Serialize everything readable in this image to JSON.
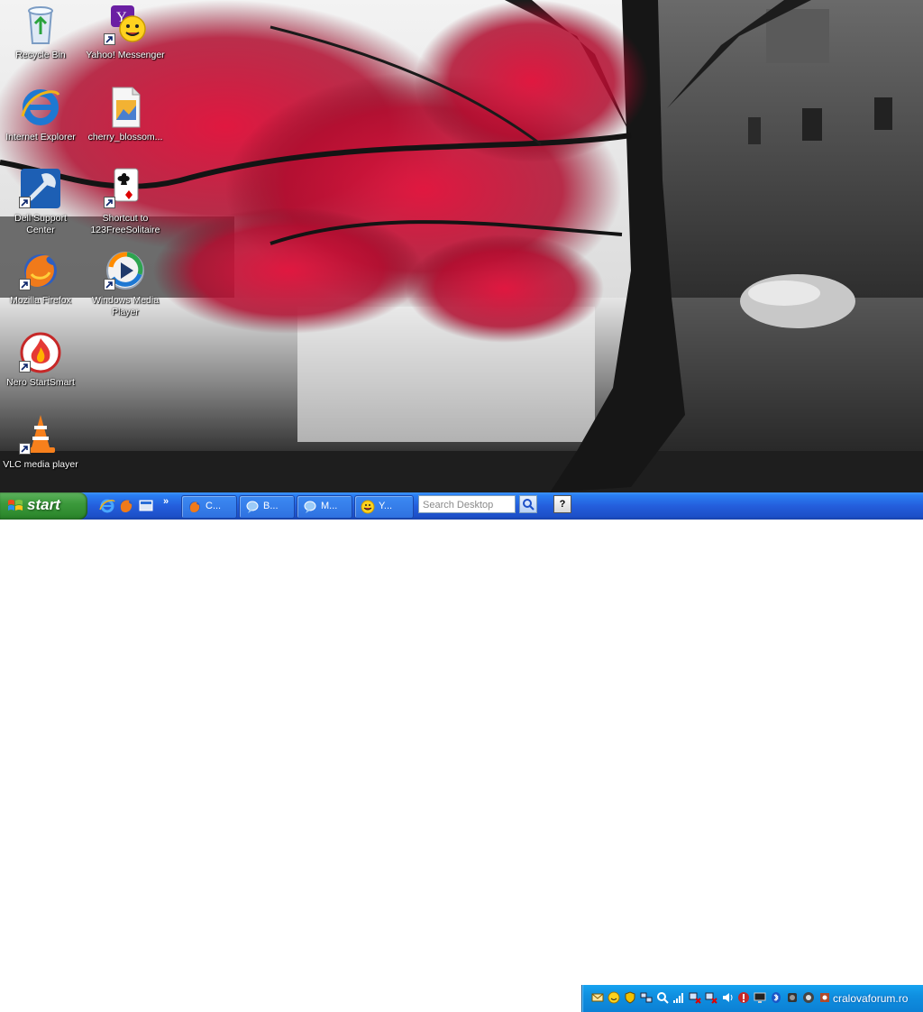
{
  "desktop": {
    "icons": [
      {
        "label": "Recycle Bin",
        "icon": "recycle-bin-icon",
        "shortcut": false
      },
      {
        "label": "Yahoo! Messenger",
        "icon": "yahoo-messenger-icon",
        "shortcut": true
      },
      {
        "label": "Internet Explorer",
        "icon": "internet-explorer-icon",
        "shortcut": false
      },
      {
        "label": "cherry_blossom...",
        "icon": "image-file-icon",
        "shortcut": false
      },
      {
        "label": "Dell Support Center",
        "line1": "Dell Support",
        "line2": "Center",
        "icon": "dell-support-icon",
        "shortcut": true
      },
      {
        "label": "Shortcut to 123FreeSolitaire",
        "line1": "Shortcut to",
        "line2": "123FreeSolitaire",
        "icon": "solitaire-icon",
        "shortcut": true
      },
      {
        "label": "Mozilla Firefox",
        "icon": "firefox-icon",
        "shortcut": true
      },
      {
        "label": "Windows Media Player",
        "line1": "Windows Media",
        "line2": "Player",
        "icon": "media-player-icon",
        "shortcut": true
      },
      {
        "label": "Nero StartSmart",
        "icon": "nero-icon",
        "shortcut": true
      },
      {
        "label": "VLC media player",
        "icon": "vlc-icon",
        "shortcut": true
      }
    ]
  },
  "taskbar": {
    "start_label": "start",
    "quick_launch": [
      "internet-explorer-icon",
      "firefox-icon",
      "show-desktop-icon"
    ],
    "overflow_label": "»",
    "tasks": [
      {
        "label": "C...",
        "icon": "firefox-icon"
      },
      {
        "label": "B...",
        "icon": "messenger-icon"
      },
      {
        "label": "M...",
        "icon": "messenger-icon"
      },
      {
        "label": "Y...",
        "icon": "yahoo-messenger-icon"
      }
    ],
    "search_placeholder": "Search Desktop",
    "help_label": "?",
    "tray_icons": [
      "mail-icon",
      "yahoo-icon",
      "shield-icon",
      "network-icon",
      "bluetooth-icon",
      "volume-icon",
      "signal-icon"
    ],
    "watermark": "cralovaforum.ro"
  },
  "colors": {
    "taskbar": "#245edc",
    "start": "#3c9a3c",
    "tray": "#0f8fe0"
  }
}
